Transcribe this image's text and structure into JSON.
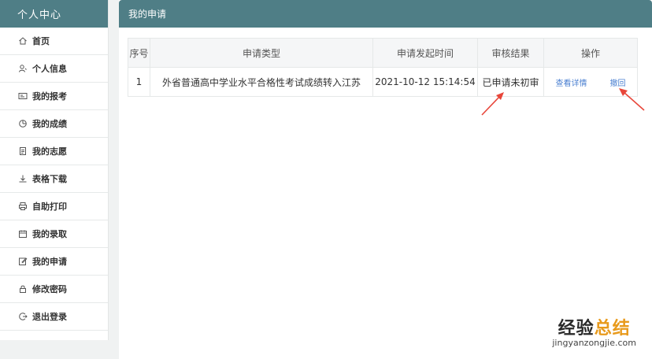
{
  "sidebar": {
    "title": "个人中心",
    "items": [
      {
        "label": "首页",
        "icon": "home-icon"
      },
      {
        "label": "个人信息",
        "icon": "user-icon"
      },
      {
        "label": "我的报考",
        "icon": "id-card-icon"
      },
      {
        "label": "我的成绩",
        "icon": "pie-chart-icon"
      },
      {
        "label": "我的志愿",
        "icon": "document-icon"
      },
      {
        "label": "表格下载",
        "icon": "download-icon"
      },
      {
        "label": "自助打印",
        "icon": "printer-icon"
      },
      {
        "label": "我的录取",
        "icon": "calendar-icon"
      },
      {
        "label": "我的申请",
        "icon": "edit-icon"
      },
      {
        "label": "修改密码",
        "icon": "lock-icon"
      },
      {
        "label": "退出登录",
        "icon": "logout-icon"
      }
    ]
  },
  "main": {
    "title": "我的申请",
    "table": {
      "headers": [
        "序号",
        "申请类型",
        "申请发起时间",
        "审核结果",
        "操作"
      ],
      "rows": [
        {
          "index": "1",
          "type": "外省普通高中学业水平合格性考试成绩转入江苏",
          "time": "2021-10-12 15:14:54",
          "result": "已申请未初审",
          "actions": {
            "detail": "查看详情",
            "revoke": "撤回"
          }
        }
      ]
    }
  },
  "watermark": {
    "text_a": "经验",
    "text_b": "总结",
    "url": "jingyanzongjie.com"
  },
  "colors": {
    "header_bg": "#4f7e86",
    "link": "#4a7fd0",
    "arrow": "#e8463a",
    "watermark_accent": "#e89a1c"
  }
}
